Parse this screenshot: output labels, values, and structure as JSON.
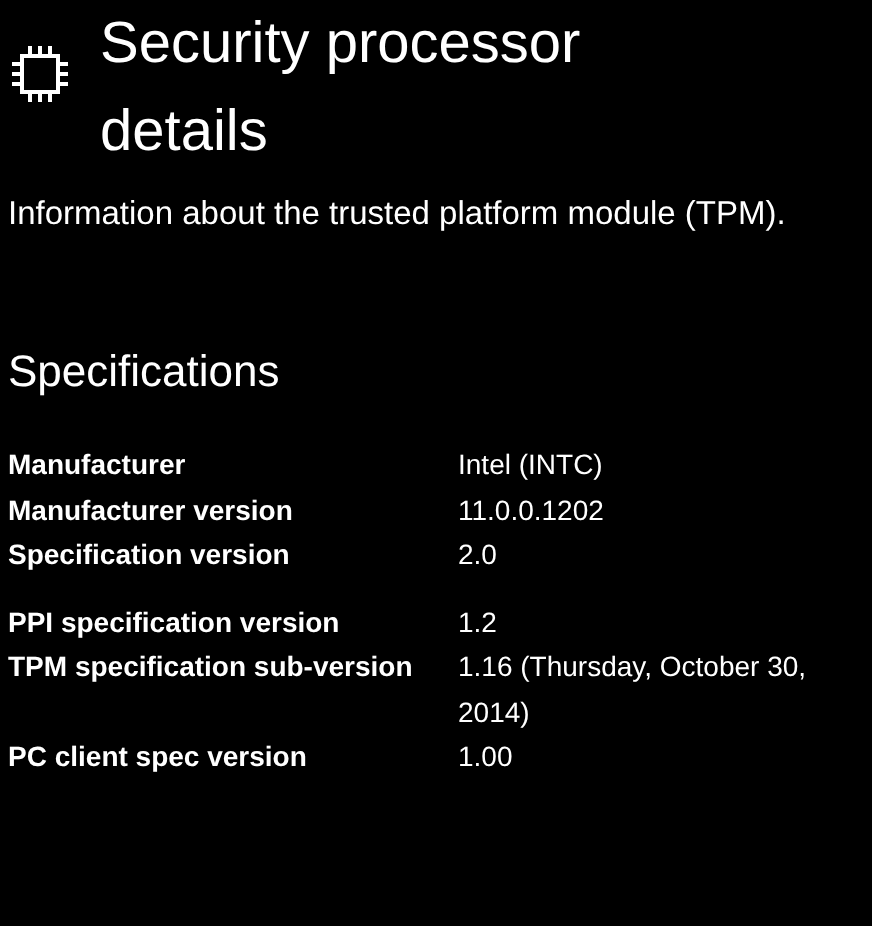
{
  "header": {
    "title": "Security processor details"
  },
  "description": "Information about the trusted platform module (TPM).",
  "specifications": {
    "heading": "Specifications",
    "groups": [
      {
        "rows": [
          {
            "label": "Manufacturer",
            "value": "Intel (INTC)"
          },
          {
            "label": "Manufacturer version",
            "value": "11.0.0.1202"
          },
          {
            "label": "Specification version",
            "value": "2.0"
          }
        ]
      },
      {
        "rows": [
          {
            "label": "PPI specification version",
            "value": "1.2"
          },
          {
            "label": "TPM specification sub-version",
            "value": "1.16 (Thursday, October 30, 2014)"
          },
          {
            "label": "PC client spec version",
            "value": "1.00"
          }
        ]
      }
    ]
  }
}
